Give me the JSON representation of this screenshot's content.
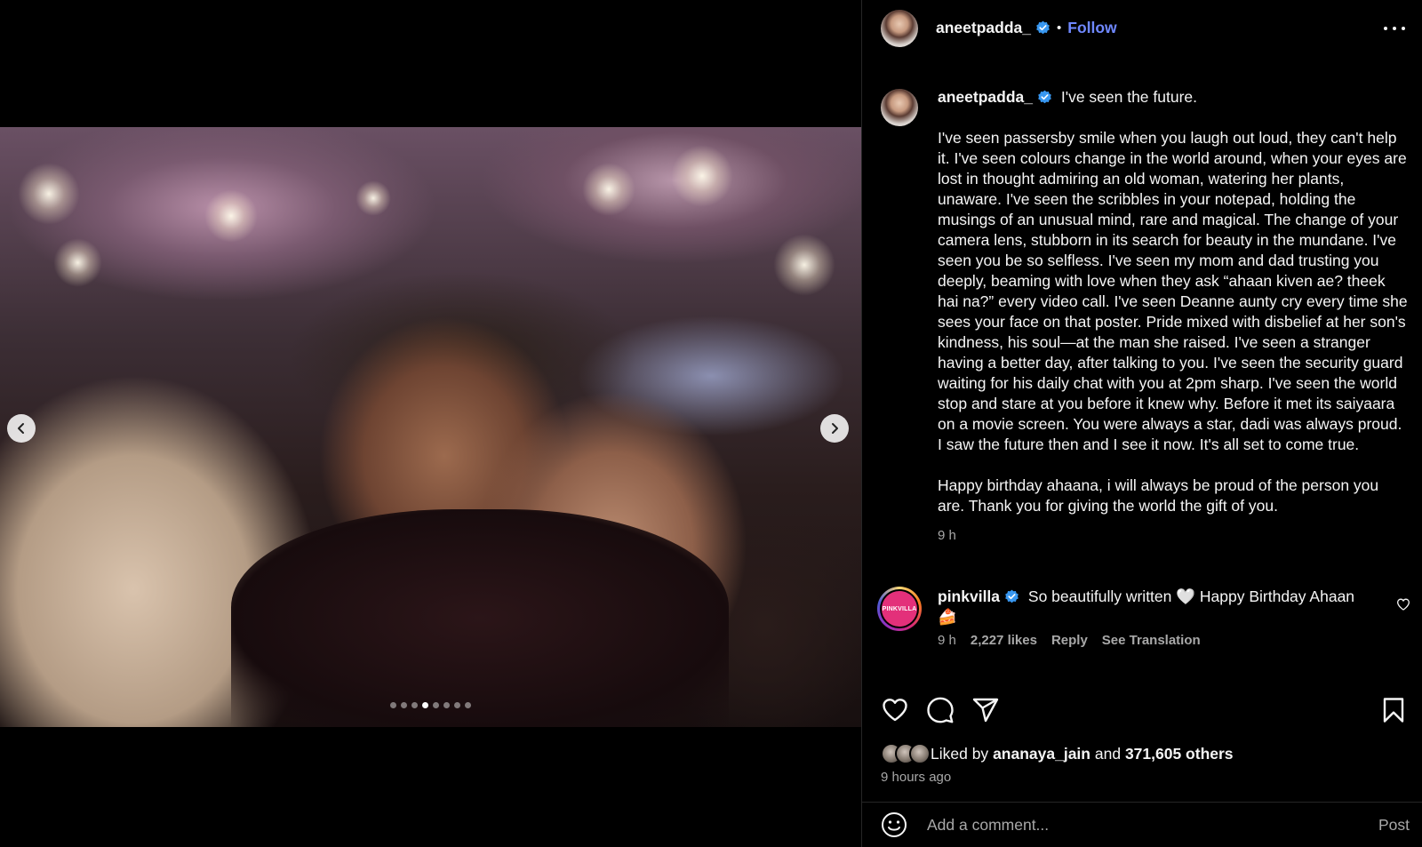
{
  "media": {
    "slide_count": 8,
    "active_slide": 4,
    "icons": {
      "prev": "chevron-left-icon",
      "next": "chevron-right-icon"
    }
  },
  "header": {
    "username": "aneetpadda_",
    "separator": "•",
    "follow_label": "Follow",
    "more_icon": "more-horizontal-icon"
  },
  "caption": {
    "username": "aneetpadda_",
    "title": "I've seen the future.",
    "paragraphs": [
      "I've seen passersby smile when you laugh out loud, they can't help it. I've seen colours change in the world around, when your eyes are lost in thought admiring an old woman, watering her plants, unaware. I've seen the scribbles in your notepad, holding the musings of an unusual mind, rare and magical. The change of your camera lens, stubborn in its search for beauty in the mundane. I've seen you be so selfless. I've seen my mom and dad trusting you deeply, beaming with love when they ask “ahaan kiven ae? theek hai na?” every video call. I've seen Deanne aunty cry every time she sees your face on that poster. Pride mixed with disbelief at her son's kindness, his soul—at the man she raised. I've seen a stranger having a better day, after talking to you. I've seen the security guard waiting for his daily chat with you at 2pm sharp. I've seen the world stop and stare at you before it knew why. Before it met its saiyaara on a movie screen. You were always a star, dadi was always proud. I saw the future then and I see it now. It's all set to come true.",
      "Happy birthday ahaana, i will always be proud of the person you are. Thank you for giving the world the gift of you."
    ],
    "time": "9 h"
  },
  "comment": {
    "avatar_text": "PINKVILLA",
    "username": "pinkvilla",
    "text": "So beautifully written 🤍 Happy Birthday Ahaan 🍰",
    "time": "9 h",
    "likes": "2,227 likes",
    "reply_label": "Reply",
    "translation_label": "See Translation"
  },
  "actions": {
    "icons": [
      "heart-icon",
      "comment-icon",
      "share-icon",
      "bookmark-icon"
    ]
  },
  "likes": {
    "prefix": "Liked by",
    "user": "ananaya_jain",
    "middle": "and",
    "others": "371,605 others"
  },
  "posted_ago": "9 hours ago",
  "comment_input": {
    "placeholder": "Add a comment...",
    "post_label": "Post"
  },
  "colors": {
    "follow": "#6f88ff",
    "verified": "#3897f0",
    "muted": "#a8a8a8"
  }
}
